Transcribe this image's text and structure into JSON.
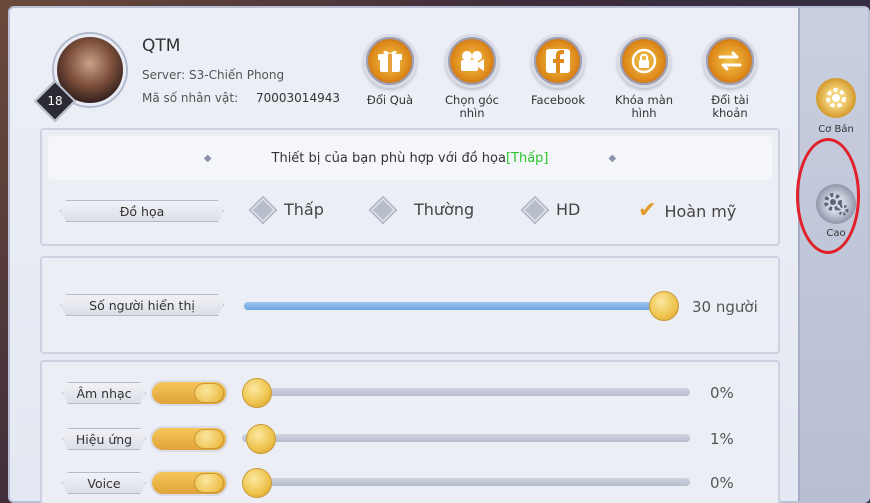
{
  "player": {
    "name": "QTM",
    "server": "Server: S3-Chiến Phong",
    "id_label": "Mã số nhân vật:",
    "id_value": "70003014943",
    "level": "18"
  },
  "header_buttons": [
    {
      "label": "Đổi Quà",
      "icon": "gift-icon"
    },
    {
      "label": "Chọn góc nhìn",
      "icon": "camera-icon"
    },
    {
      "label": "Facebook",
      "icon": "facebook-icon"
    },
    {
      "label": "Khóa màn hình",
      "icon": "lock-icon"
    },
    {
      "label": "Đổi tài khoản",
      "icon": "swap-icon"
    }
  ],
  "side_tabs": [
    {
      "label": "Cơ Bản",
      "icon": "gear-icon"
    },
    {
      "label": "Cao",
      "icon": "gears-icon"
    }
  ],
  "graphics": {
    "notice_prefix": "Thiết bị của bạn phù hợp với đồ họa",
    "notice_level": "[Thấp]",
    "label": "Đồ họa",
    "options": [
      "Thấp",
      "Thường",
      "HD",
      "Hoàn mỹ"
    ],
    "selected": "Hoàn mỹ"
  },
  "players_shown": {
    "label": "Số người hiển thị",
    "value_text": "30 người",
    "fraction": 1.0
  },
  "audio": [
    {
      "label": "Âm nhạc",
      "value_text": "0%",
      "fraction": 0.0
    },
    {
      "label": "Hiệu ứng",
      "value_text": "1%",
      "fraction": 0.01
    },
    {
      "label": "Voice",
      "value_text": "0%",
      "fraction": 0.0
    }
  ],
  "colors": {
    "accent": "#e8ad38",
    "recommended": "#2bc42b",
    "highlight_ring": "#e0202a"
  }
}
